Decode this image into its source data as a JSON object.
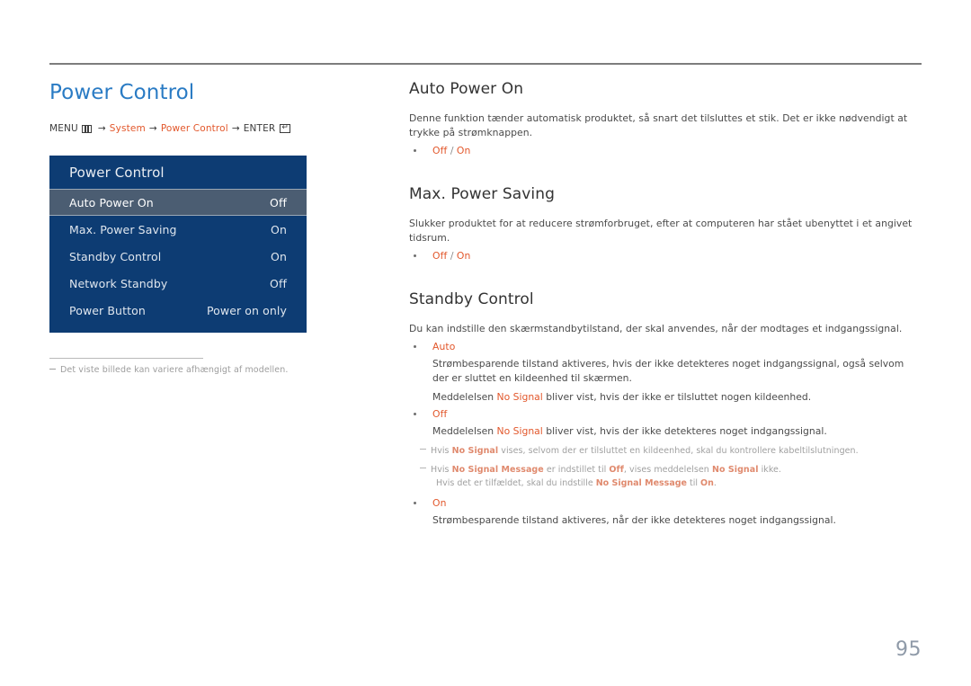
{
  "page": {
    "number": "95",
    "title": "Power Control"
  },
  "breadcrumb": {
    "menu_label": "MENU",
    "menu_icon": "menu-icon",
    "arrow": "→",
    "item1": "System",
    "item2": "Power Control",
    "enter_label": "ENTER",
    "enter_icon": "enter-key-icon"
  },
  "osd": {
    "header": "Power Control",
    "rows": [
      {
        "label": "Auto Power On",
        "value": "Off",
        "selected": true
      },
      {
        "label": "Max. Power Saving",
        "value": "On",
        "selected": false
      },
      {
        "label": "Standby Control",
        "value": "On",
        "selected": false
      },
      {
        "label": "Network Standby",
        "value": "Off",
        "selected": false
      },
      {
        "label": "Power Button",
        "value": "Power on only",
        "selected": false
      }
    ]
  },
  "footnote": "Det viste billede kan variere afhængigt af modellen.",
  "sections": [
    {
      "title": "Auto Power On",
      "body": "Denne funktion tænder automatisk produktet, så snart det tilsluttes et stik. Det er ikke nødvendigt at trykke på strømknappen.",
      "option_off": "Off",
      "option_sep": "/",
      "option_on": "On"
    },
    {
      "title": "Max. Power Saving",
      "body": "Slukker produktet for at reducere strømforbruget, efter at computeren har stået ubenyttet i et angivet tidsrum.",
      "option_off": "Off",
      "option_sep": "/",
      "option_on": "On"
    },
    {
      "title": "Standby Control",
      "body": "Du kan indstille den skærmstandbytilstand, der skal anvendes, når der modtages et indgangssignal.",
      "auto": {
        "label": "Auto",
        "para1": "Strømbesparende tilstand aktiveres, hvis der ikke detekteres noget indgangssignal, også selvom der er sluttet en kildeenhed til skærmen.",
        "para2_pre": "Meddelelsen ",
        "para2_kw": "No Signal",
        "para2_post": " bliver vist, hvis der ikke er tilsluttet nogen kildeenhed."
      },
      "off": {
        "label": "Off",
        "para1_pre": "Meddelelsen ",
        "para1_kw": "No Signal",
        "para1_post": " bliver vist, hvis der ikke detekteres noget indgangssignal.",
        "note1_pre": "Hvis ",
        "note1_kw": "No Signal",
        "note1_post": " vises, selvom der er tilsluttet en kildeenhed, skal du kontrollere kabeltilslutningen.",
        "note2_pre": "Hvis ",
        "note2_kw1": "No Signal Message",
        "note2_mid1": " er indstillet til ",
        "note2_kw2": "Off",
        "note2_mid2": ", vises meddelelsen ",
        "note2_kw3": "No Signal",
        "note2_post": " ikke.",
        "note3_pre": "Hvis det er tilfældet, skal du indstille ",
        "note3_kw1": "No Signal Message",
        "note3_mid": " til ",
        "note3_kw2": "On",
        "note3_post": "."
      },
      "on": {
        "label": "On",
        "para1": "Strømbesparende tilstand aktiveres, når der ikke detekteres noget indgangssignal."
      }
    }
  ],
  "colors": {
    "title_blue": "#2a7bc4",
    "accent_orange": "#e2572b",
    "osd_navy": "#0d3c73",
    "osd_selected": "#4b5d72"
  }
}
